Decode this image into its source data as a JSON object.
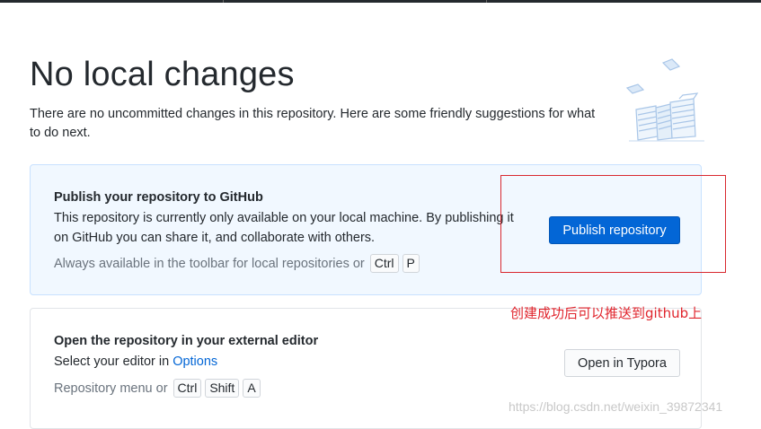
{
  "header": {
    "title": "No local changes",
    "subtitle": "There are no uncommitted changes in this repository. Here are some friendly suggestions for what to do next."
  },
  "illustration": {
    "icon": "paper-stacks-illustration-icon"
  },
  "publish_card": {
    "title": "Publish your repository to GitHub",
    "description": "This repository is currently only available on your local machine. By publishing it on GitHub you can share it, and collaborate with others.",
    "hint": "Always available in the toolbar for local repositories or",
    "shortcut": [
      "Ctrl",
      "P"
    ],
    "button_label": "Publish repository"
  },
  "editor_card": {
    "title": "Open the repository in your external editor",
    "description_prefix": "Select your editor in",
    "description_link": "Options",
    "hint": "Repository menu or",
    "shortcut": [
      "Ctrl",
      "Shift",
      "A"
    ],
    "button_label": "Open in Typora"
  },
  "annotation": {
    "text": "创建成功后可以推送到github上",
    "color": "#e0242c"
  },
  "watermark": "https://blog.csdn.net/weixin_39872341",
  "colors": {
    "accent": "#0366d6",
    "publish_bg": "#f1f8ff",
    "annotation_red": "#d9282f"
  }
}
